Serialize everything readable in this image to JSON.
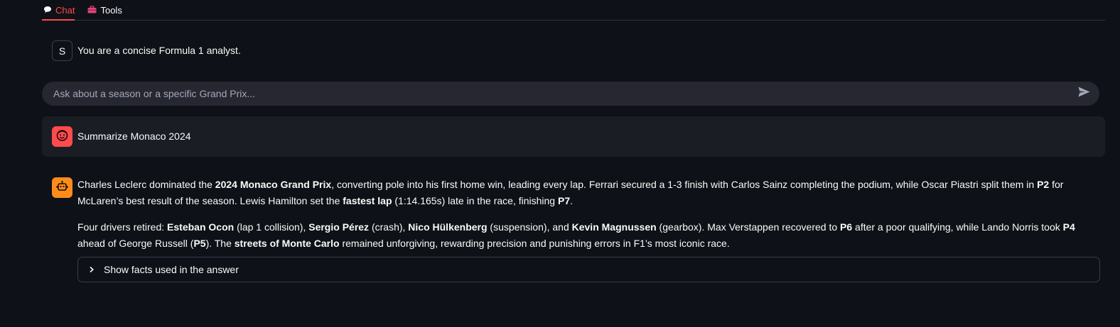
{
  "tabs": [
    {
      "label": "Chat",
      "icon": "speech-bubble-icon",
      "active": true
    },
    {
      "label": "Tools",
      "icon": "toolbox-icon",
      "active": false
    }
  ],
  "system_message": {
    "avatar_letter": "S",
    "text": "You are a concise Formula 1 analyst."
  },
  "chat_input": {
    "placeholder": "Ask about a season or a specific Grand Prix..."
  },
  "user_message": {
    "text": "Summarize Monaco 2024"
  },
  "assistant_message": {
    "p1": {
      "s1": "Charles Leclerc dominated the ",
      "b1": "2024 Monaco Grand Prix",
      "s2": ", converting pole into his first home win, leading every lap. Ferrari secured a 1-3 finish with Carlos Sainz completing the podium, while Oscar Piastri split them in ",
      "b2": "P2",
      "s3": " for McLaren’s best result of the season. Lewis Hamilton set the ",
      "b3": "fastest lap",
      "s4": " (1:14.165s) late in the race, finishing ",
      "b4": "P7",
      "s5": "."
    },
    "p2": {
      "s1": "Four drivers retired: ",
      "b1": "Esteban Ocon",
      "s2": " (lap 1 collision), ",
      "b2": "Sergio Pérez",
      "s3": " (crash), ",
      "b3": "Nico Hülkenberg",
      "s4": " (suspension), and ",
      "b4": "Kevin Magnussen",
      "s5": " (gearbox). Max Verstappen recovered to ",
      "b5": "P6",
      "s6": " after a poor qualifying, while Lando Norris took ",
      "b6": "P4",
      "s7": " ahead of George Russell (",
      "b7": "P5",
      "s8": "). The ",
      "b8": "streets of Monte Carlo",
      "s9": " remained unforgiving, rewarding precision and punishing errors in F1’s most iconic race."
    },
    "expander_label": "Show facts used in the answer"
  },
  "colors": {
    "background": "#0e1117",
    "accent": "#ff4b4b",
    "assistant_avatar": "#ff8c1a",
    "input_bg": "#262730"
  }
}
